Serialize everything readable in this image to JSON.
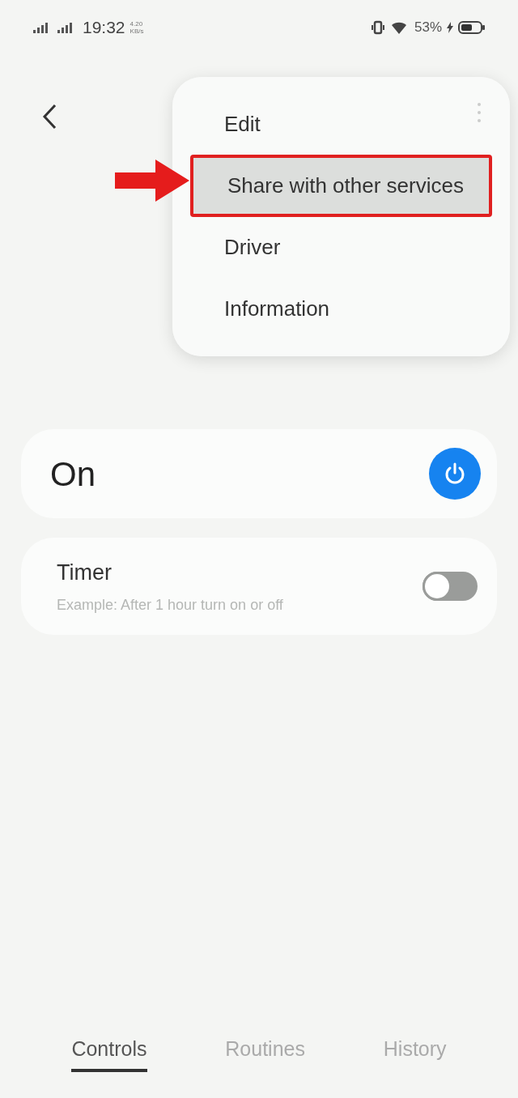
{
  "status_bar": {
    "time": "19:32",
    "net_speed": [
      "4.20",
      "KB/s"
    ],
    "battery": "53%",
    "charging": true
  },
  "menu": {
    "items": [
      {
        "label": "Edit",
        "selected": false
      },
      {
        "label": "Share with other services",
        "selected": true
      },
      {
        "label": "Driver",
        "selected": false
      },
      {
        "label": "Information",
        "selected": false
      }
    ]
  },
  "power_card": {
    "label": "On",
    "on": true
  },
  "timer_card": {
    "title": "Timer",
    "subtitle": "Example: After 1 hour turn on or off",
    "on": false
  },
  "tabs": [
    {
      "label": "Controls",
      "selected": true
    },
    {
      "label": "Routines",
      "selected": false
    },
    {
      "label": "History",
      "selected": false
    }
  ]
}
